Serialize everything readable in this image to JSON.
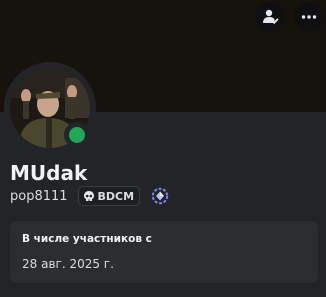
{
  "profile": {
    "display_name": "MUdak",
    "username": "pop8111",
    "status": "online",
    "status_color": "#23a55a",
    "guild_tag": {
      "icon": "skull-icon",
      "text": "BDCM"
    },
    "badges": [
      "nitro-gem-icon"
    ]
  },
  "header": {
    "buttons": [
      "view-profile-icon",
      "more-options-icon"
    ]
  },
  "member_since": {
    "title": "В числе участников с",
    "date": "28 авг. 2025 г."
  },
  "colors": {
    "background": "#232428",
    "banner": "#16120c",
    "section": "#2b2d31",
    "accent_badge": "#7984f5"
  }
}
